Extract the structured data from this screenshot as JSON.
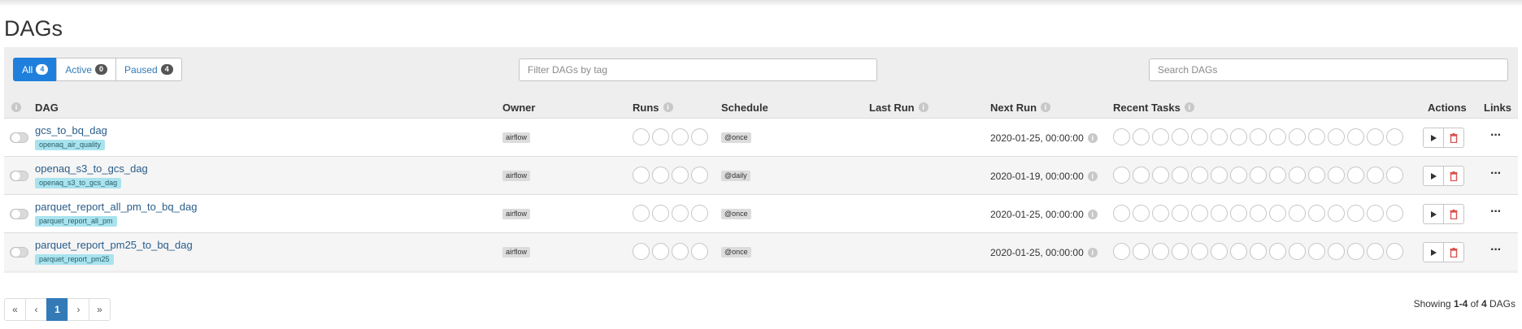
{
  "page_title": "DAGs",
  "filters": {
    "status_tabs": [
      {
        "label": "All",
        "count": "4"
      },
      {
        "label": "Active",
        "count": "0"
      },
      {
        "label": "Paused",
        "count": "4"
      }
    ],
    "tag_placeholder": "Filter DAGs by tag",
    "search_placeholder": "Search DAGs"
  },
  "table": {
    "headers": {
      "dag": "DAG",
      "owner": "Owner",
      "runs": "Runs",
      "schedule": "Schedule",
      "last_run": "Last Run",
      "next_run": "Next Run",
      "recent_tasks": "Recent Tasks",
      "actions": "Actions",
      "links": "Links"
    },
    "rows": [
      {
        "dag_id": "gcs_to_bq_dag",
        "tag": "openaq_air_quality",
        "owner": "airflow",
        "schedule": "@once",
        "next_run": "2020-01-25, 00:00:00"
      },
      {
        "dag_id": "openaq_s3_to_gcs_dag",
        "tag": "openaq_s3_to_gcs_dag",
        "owner": "airflow",
        "schedule": "@daily",
        "next_run": "2020-01-19, 00:00:00"
      },
      {
        "dag_id": "parquet_report_all_pm_to_bq_dag",
        "tag": "parquet_report_all_pm",
        "owner": "airflow",
        "schedule": "@once",
        "next_run": "2020-01-25, 00:00:00"
      },
      {
        "dag_id": "parquet_report_pm25_to_bq_dag",
        "tag": "parquet_report_pm25",
        "owner": "airflow",
        "schedule": "@once",
        "next_run": "2020-01-25, 00:00:00"
      }
    ]
  },
  "pagination": {
    "first": "«",
    "prev": "‹",
    "current": "1",
    "next": "›",
    "last": "»"
  },
  "showing": {
    "prefix": "Showing ",
    "range": "1-4",
    "of": " of ",
    "total": "4",
    "suffix": " DAGs"
  },
  "icons": {
    "info": "info-icon",
    "play": "play-icon",
    "delete": "trash-icon",
    "links": "more-horizontal-icon",
    "toggle": "toggle-switch-icon"
  },
  "colors": {
    "accent": "#1f7fdc",
    "link": "#2a5d8a",
    "tag_bg": "#a8e3ee",
    "delete": "#d9534f"
  }
}
